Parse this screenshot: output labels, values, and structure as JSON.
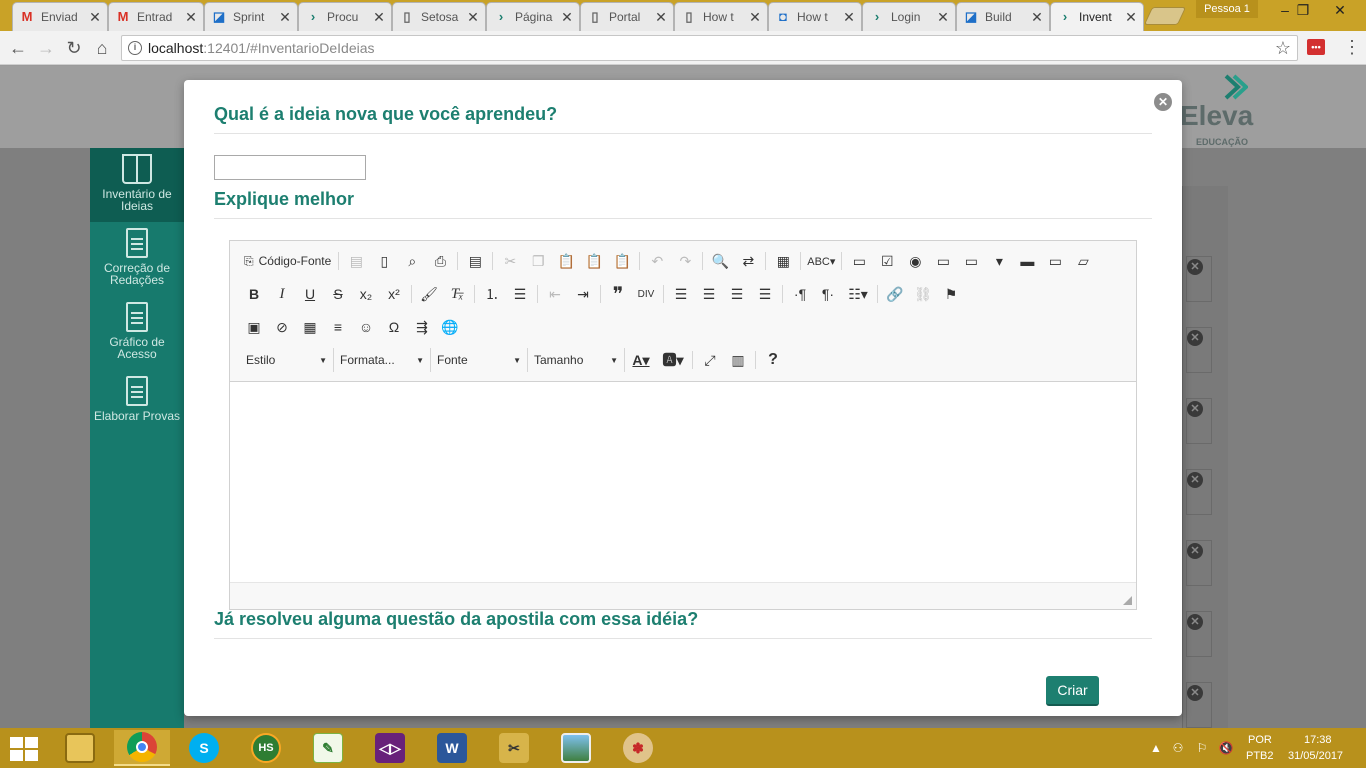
{
  "browser": {
    "tabs": [
      {
        "label": "Enviad",
        "icon": "gmail-icon",
        "active": false
      },
      {
        "label": "Entrad",
        "icon": "gmail-icon",
        "active": false
      },
      {
        "label": "Sprint",
        "icon": "vsts-icon",
        "active": false
      },
      {
        "label": "Procu",
        "icon": "chevron-icon",
        "active": false
      },
      {
        "label": "Setosa",
        "icon": "page-icon",
        "active": false
      },
      {
        "label": "Página",
        "icon": "chevron-icon",
        "active": false
      },
      {
        "label": "Portal",
        "icon": "page-icon",
        "active": false
      },
      {
        "label": "How t",
        "icon": "page-icon",
        "active": false
      },
      {
        "label": "How t",
        "icon": "chat-icon",
        "active": false
      },
      {
        "label": "Login",
        "icon": "chevron-icon",
        "active": false
      },
      {
        "label": "Build",
        "icon": "vsts-icon",
        "active": false
      },
      {
        "label": "Invent",
        "icon": "chevron-icon",
        "active": true
      }
    ],
    "profile": "Pessoa 1",
    "url_host": "localhost",
    "url_path": ":12401/#InventarioDeIdeias",
    "colors": {
      "accent": "#c9a227",
      "teal": "#1d7f70"
    }
  },
  "sidebar": {
    "items": [
      {
        "label": "Inventário de Ideias",
        "icon": "book-icon",
        "active": true
      },
      {
        "label": "Correção de Redações",
        "icon": "document-icon",
        "active": false
      },
      {
        "label": "Gráfico de Acesso",
        "icon": "document-icon",
        "active": false
      },
      {
        "label": "Elaborar Provas",
        "icon": "document-icon",
        "active": false
      }
    ]
  },
  "logo": {
    "name": "Eleva",
    "subtitle": "EDUCAÇÃO"
  },
  "modal": {
    "question1": "Qual é a ideia nova que você aprendeu?",
    "input_value": "",
    "question2": "Explique melhor",
    "question3": "Já resolveu alguma questão da apostila com essa idéia?",
    "submit_label": "Criar",
    "editor": {
      "source_label": "Código-Fonte",
      "combo_style": "Estilo",
      "combo_format": "Formata...",
      "combo_font": "Fonte",
      "combo_size": "Tamanho",
      "content": ""
    }
  },
  "taskbar": {
    "apps": [
      "file-explorer",
      "chrome",
      "skype",
      "hs",
      "notepad-plus",
      "visual-studio",
      "word",
      "tools",
      "photos",
      "paint"
    ],
    "lang_top": "POR",
    "lang_bottom": "PTB2",
    "time": "17:38",
    "date": "31/05/2017"
  }
}
